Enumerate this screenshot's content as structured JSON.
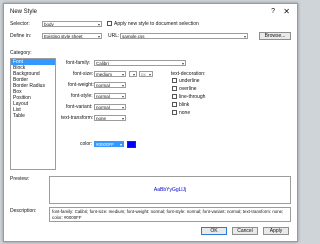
{
  "window": {
    "title": "New Style",
    "help_glyph": "?",
    "close_glyph": "✕"
  },
  "header": {
    "selector_label": "Selector:",
    "selector_value": "body",
    "apply_label": "Apply new style to document selection",
    "define_label": "Define in:",
    "define_value": "Existing style sheet",
    "url_label": "URL:",
    "url_value": "sample.css",
    "browse_label": "Browse..."
  },
  "category": {
    "label": "Category:",
    "items": [
      "Font",
      "Block",
      "Background",
      "Border",
      "Border Radius",
      "Box",
      "Position",
      "Layout",
      "List",
      "Table"
    ],
    "selected_index": 0
  },
  "font": {
    "family_label": "font-family:",
    "family_value": "Calibri",
    "size_label": "font-size:",
    "size_value": "medium",
    "size_unit": "px",
    "weight_label": "font-weight:",
    "weight_value": "normal",
    "style_label": "font-style:",
    "style_value": "normal",
    "variant_label": "font-variant:",
    "variant_value": "normal",
    "transform_label": "text-transform:",
    "transform_value": "none",
    "color_label": "color:",
    "color_value": "#0000FF",
    "color_hex": "#0000ff"
  },
  "decoration": {
    "label": "text-decoration:",
    "options": [
      "underline",
      "overline",
      "line-through",
      "blink",
      "none"
    ]
  },
  "preview": {
    "label": "Preview:",
    "sample": "AaBbYyGgLlJj"
  },
  "description": {
    "label": "Description:",
    "text": "font-family: Calibri; font-size: medium; font-weight: normal; font-style: normal; font-variant: normal; text-transform: none; color: #0000FF"
  },
  "buttons": {
    "ok": "OK",
    "cancel": "Cancel",
    "apply": "Apply"
  },
  "icons": {
    "dropdown": "chevron-down-icon",
    "close": "close-icon",
    "help": "help-icon"
  }
}
